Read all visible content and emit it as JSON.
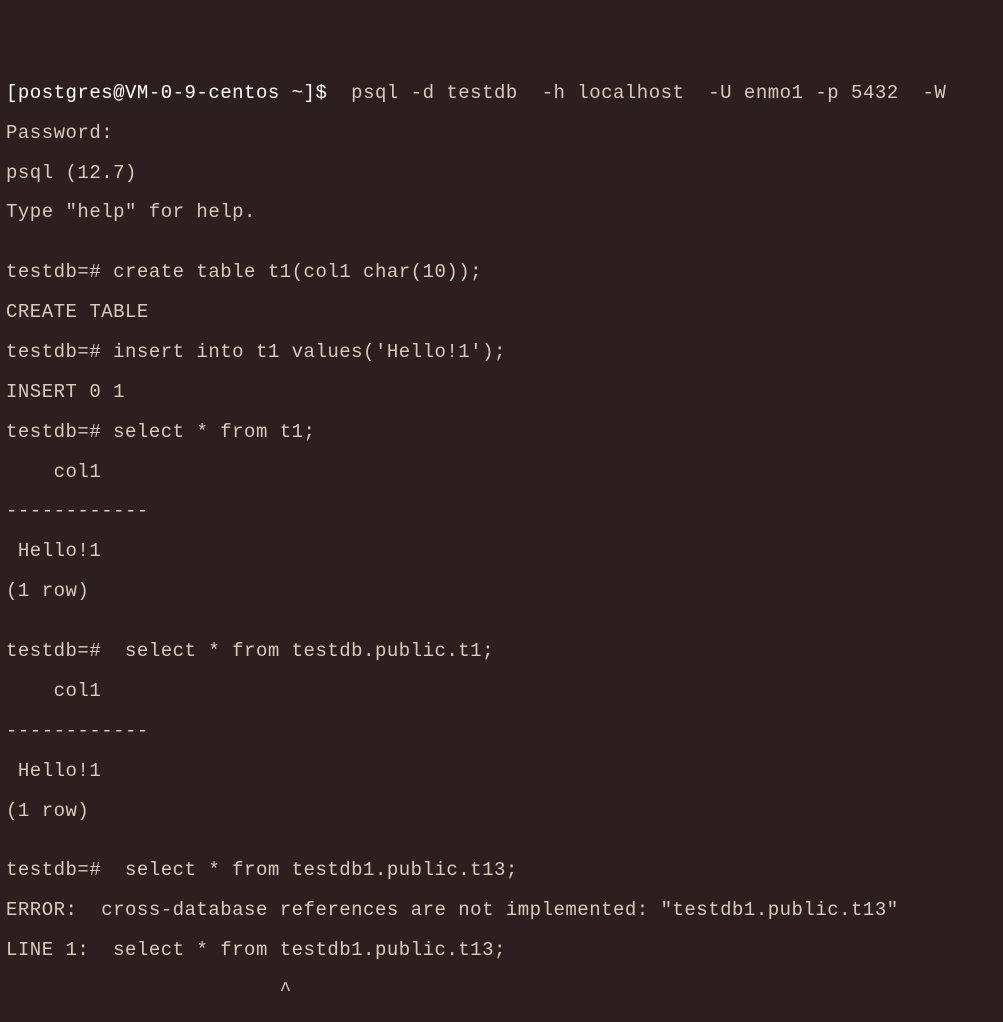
{
  "lines": {
    "l1_prompt": "[postgres@VM-0-9-centos ~]$ ",
    "l1_cmd": " psql -d testdb  -h localhost  -U enmo1 -p 5432  -W",
    "l2": "Password:",
    "l3": "psql (12.7)",
    "l4": "Type \"help\" for help.",
    "l5": "",
    "l6": "testdb=# create table t1(col1 char(10));",
    "l7": "CREATE TABLE",
    "l8": "testdb=# insert into t1 values('Hello!1');",
    "l9": "INSERT 0 1",
    "l10": "testdb=# select * from t1;",
    "l11": "    col1",
    "l12": "------------",
    "l13": " Hello!1",
    "l14": "(1 row)",
    "l15": "",
    "l16": "testdb=#  select * from testdb.public.t1;",
    "l17": "    col1",
    "l18": "------------",
    "l19": " Hello!1",
    "l20": "(1 row)",
    "l21": "",
    "l22": "testdb=#  select * from testdb1.public.t13;",
    "l23": "ERROR:  cross-database references are not implemented: \"testdb1.public.t13\"",
    "l24": "LINE 1:  select * from testdb1.public.t13;",
    "l25": "                       ^"
  }
}
